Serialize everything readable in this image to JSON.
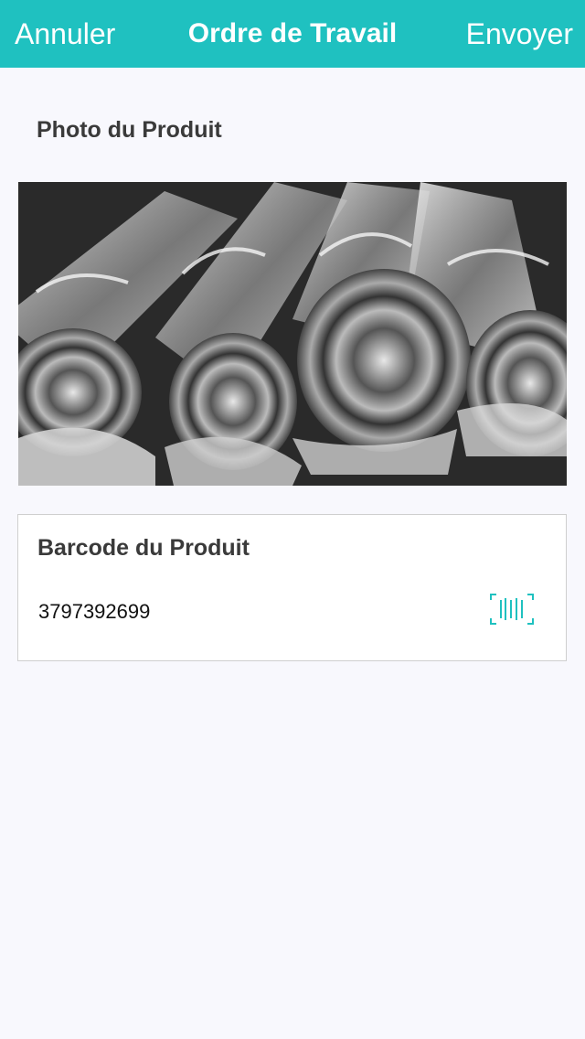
{
  "nav": {
    "cancel_label": "Annuler",
    "title": "Ordre de Travail",
    "send_label": "Envoyer"
  },
  "photo_section": {
    "title": "Photo du Produit",
    "image_description_icon": "photo-of-plastic-wrapped-rolls"
  },
  "barcode_card": {
    "title": "Barcode du Produit",
    "value": "3797392699",
    "scan_icon": "barcode-scan-icon"
  },
  "colors": {
    "accent": "#1fc1c0",
    "background": "#f8f8fd",
    "text": "#3a3a3a"
  }
}
